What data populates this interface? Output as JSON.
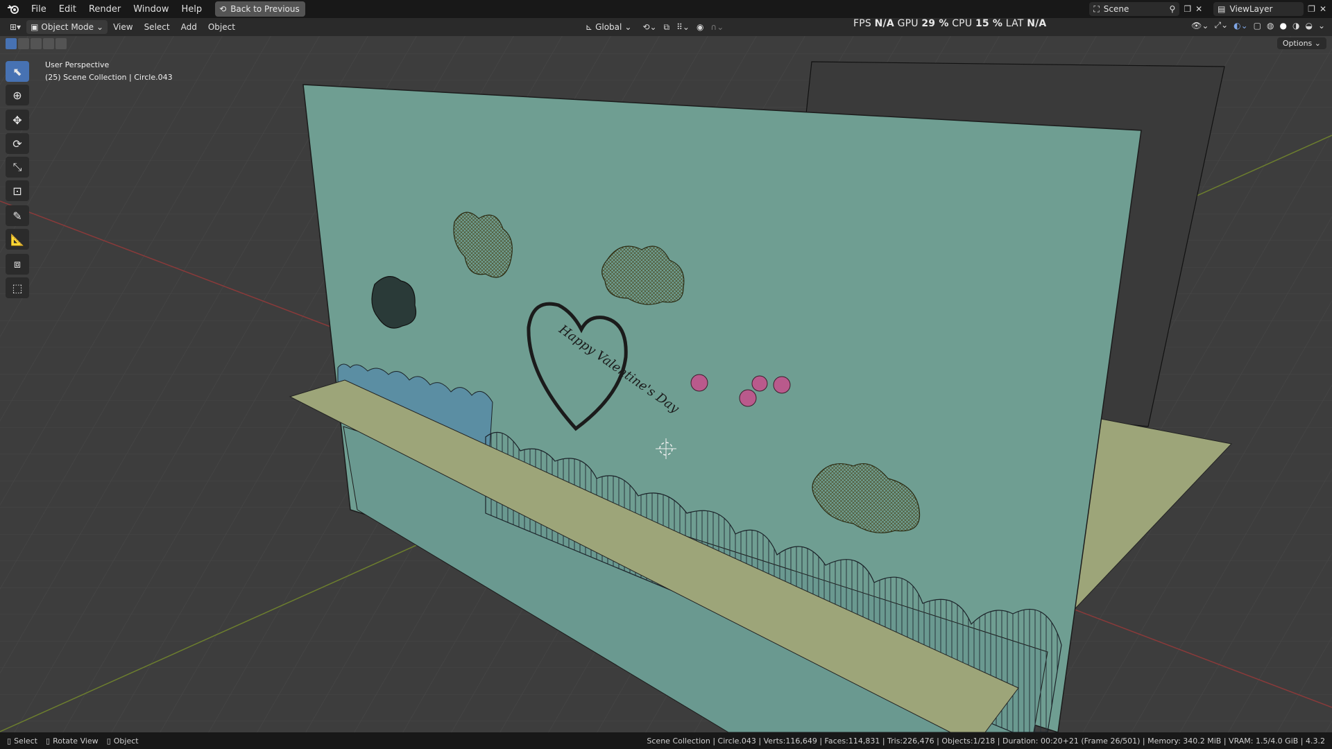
{
  "topbar": {
    "menus": [
      "File",
      "Edit",
      "Render",
      "Window",
      "Help"
    ],
    "back_label": "Back to Previous",
    "scene_label": "Scene",
    "viewlayer_label": "ViewLayer"
  },
  "header": {
    "mode_label": "Object Mode",
    "menus": [
      "View",
      "Select",
      "Add",
      "Object"
    ],
    "orientation_label": "Global",
    "options_label": "Options"
  },
  "stats": {
    "fps_label": "FPS",
    "fps_value": "N/A",
    "gpu_label": "GPU",
    "gpu_value": "29 %",
    "cpu_label": "CPU",
    "cpu_value": "15 %",
    "lat_label": "LAT",
    "lat_value": "N/A"
  },
  "viewport": {
    "view_name": "User Perspective",
    "collection_info": "(25) Scene Collection | Circle.043",
    "card_text": "Happy Valentine's Day"
  },
  "statusbar": {
    "select_label": "Select",
    "rotate_label": "Rotate View",
    "object_label": "Object",
    "info": "Scene Collection | Circle.043 | Verts:116,649 | Faces:114,831 | Tris:226,476 | Objects:1/218 | Duration: 00:20+21 (Frame 26/501) | Memory: 340.2 MiB | VRAM: 1.5/4.0 GiB | 4.3.2"
  },
  "colors": {
    "card": "#6f9e92",
    "floor_card": "#9da579",
    "viewport_bg": "#3d3d3d",
    "accent": "#4772b3"
  }
}
